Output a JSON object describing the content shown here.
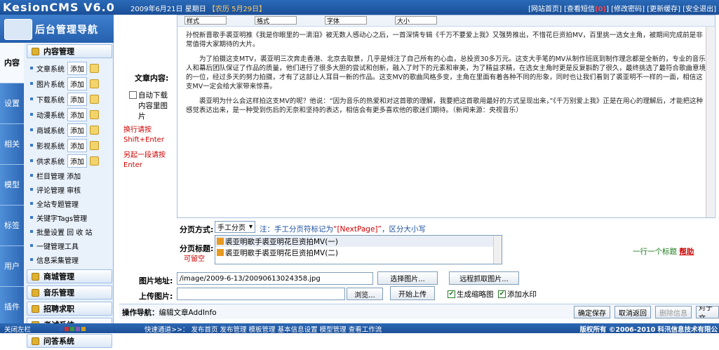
{
  "header": {
    "logo": "KesionCMS V6.0",
    "date_prefix": "2009年6月21日 星期日",
    "lunar": "【农历 5月29日】",
    "links": [
      "[网站首页]",
      "[查看短信",
      "(0)",
      "]",
      "[修改密码]",
      "[更新缓存]",
      "[安全退出]"
    ]
  },
  "sidebar": {
    "title": "后台管理导航",
    "tabs": [
      "内容",
      "设置",
      "相关",
      "模型",
      "标签",
      "用户",
      "插件"
    ],
    "content_head": "内容管理",
    "systems": [
      {
        "label": "文章系统",
        "add": "添加"
      },
      {
        "label": "图片系统",
        "add": "添加"
      },
      {
        "label": "下载系统",
        "add": "添加"
      },
      {
        "label": "动漫系统",
        "add": "添加"
      },
      {
        "label": "商城系统",
        "add": "添加"
      },
      {
        "label": "影视系统",
        "add": "添加"
      },
      {
        "label": "供求系统",
        "add": "添加"
      }
    ],
    "simple_items": [
      "栏目管理 添加",
      "评论管理 审核",
      "全站专题管理",
      "关键字Tags管理",
      "批量设置 回 收 站",
      "一键管理工具",
      "信息采集管理"
    ],
    "other_heads": [
      "商城管理",
      "音乐管理",
      "招聘求职",
      "考试系统",
      "问答系统"
    ]
  },
  "editor": {
    "label": "文章内容:",
    "checkbox_label": "自动下载内容里图片",
    "toolbar_selects": [
      "样式",
      "格式",
      "字体",
      "大小"
    ],
    "hint1": "换行请按Shift+Enter",
    "hint2": "另起一段请按Enter",
    "paragraphs": [
      "孙悦新晋歌手裘亚明推《我是你眼里的一滴泪》被无数人感动心之后，一首深情专辑《千万不要爱上我》又强势推出，不惜花巨资拍MV，百里挑一选女主角，被期间完成前是非常值得大家期待的大片。",
      "为了拍摄这支MTV，裘亚明三次奔走香港、北京去取景，几乎是倾注了自己所有的心血，总投资30多万元。这支大手笔的MV从制作班底到制作理念都是全新的，专业的音乐人和幕后团队保证了作品的质量，他们进行了很多大胆的尝试和创新，融入了时下的元素和审美，为了精益求精，在选女主角时更是反复斟酌了很久，最终挑选了最符合歌曲意境的一位，经过多天的努力拍摄，才有了这部让人耳目一新的作品。这支MV的歌曲风格多变，主角在里面有着各种不同的形象，同时也让我们看到了裘亚明不一样的一面，相信这支MV一定会给大家带来惊喜。",
      "裘亚明为什么会这样拍这支MV的呢？他说：“因为音乐的热爱和对这首歌的理解，我要把这首歌用最好的方式呈现出来，”《千万别爱上我》正是在用心的理解后，才能把这种感觉表达出来，是一种受到伤后的无奈和坚持的表达，相信会有更多喜欢他的歌迷们期待。（新闻来源：央视音乐）"
    ]
  },
  "paging": {
    "label": "分页方式:",
    "mode": "手工分页",
    "note_prefix": "注：手工分页符标记为",
    "marker": "“[NextPage]”",
    "note_suffix": "，区分大小写"
  },
  "page_titles": {
    "label": "分页标题:",
    "sub": "可留空",
    "items": [
      "裘亚明歌手裘亚明花巨资拍MV(一)",
      "裘亚明歌手裘亚明花巨资拍MV(二)"
    ],
    "right_note": "一行一个标题",
    "help": "帮助"
  },
  "image_addr": {
    "label": "图片地址:",
    "value": "/image/2009-6-13/20090613024358.jpg",
    "select_btn": "选择图片...",
    "remote_btn": "远程抓取图片..."
  },
  "upload": {
    "label": "上传图片:",
    "browse": "浏览...",
    "start": "开始上传",
    "thumb": "生成缩略图",
    "watermark": "添加水印"
  },
  "action_bar": {
    "label": "操作导航：",
    "path": "编辑文章AddInfo",
    "buttons": [
      "确定保存",
      "取消返回",
      "删除信息",
      "对于文"
    ]
  },
  "footer": {
    "left": "关闭左栏",
    "shortcut_label": "快速通道>>：",
    "links": [
      "发布首页",
      "发布管理",
      "模板管理",
      "基本信息设置",
      "模型管理",
      "查看工作流"
    ],
    "copyright": "版权所有 ©2006-2010 科汛信息技术有限公"
  }
}
